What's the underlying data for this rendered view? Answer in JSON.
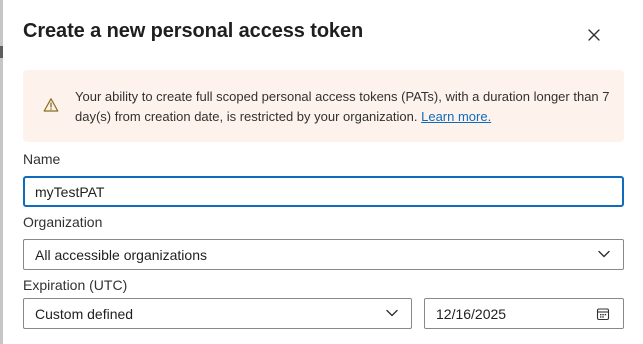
{
  "dialog": {
    "title": "Create a new personal access token",
    "close_icon": "close-icon"
  },
  "banner": {
    "icon": "warning-icon",
    "message": "Your ability to create full scoped personal access tokens (PATs), with a duration longer than 7 day(s) from creation date, is restricted by your organization.",
    "link_label": "Learn more.",
    "background_color": "#fdf3ec",
    "link_color": "#0f6cbd"
  },
  "form": {
    "name_label": "Name",
    "name_value": "myTestPAT",
    "organization_label": "Organization",
    "organization_value": "All accessible organizations",
    "expiration_label": "Expiration (UTC)",
    "expiration_value": "Custom defined",
    "date_value": "12/16/2025",
    "focus_color": "#0f6cbd"
  }
}
